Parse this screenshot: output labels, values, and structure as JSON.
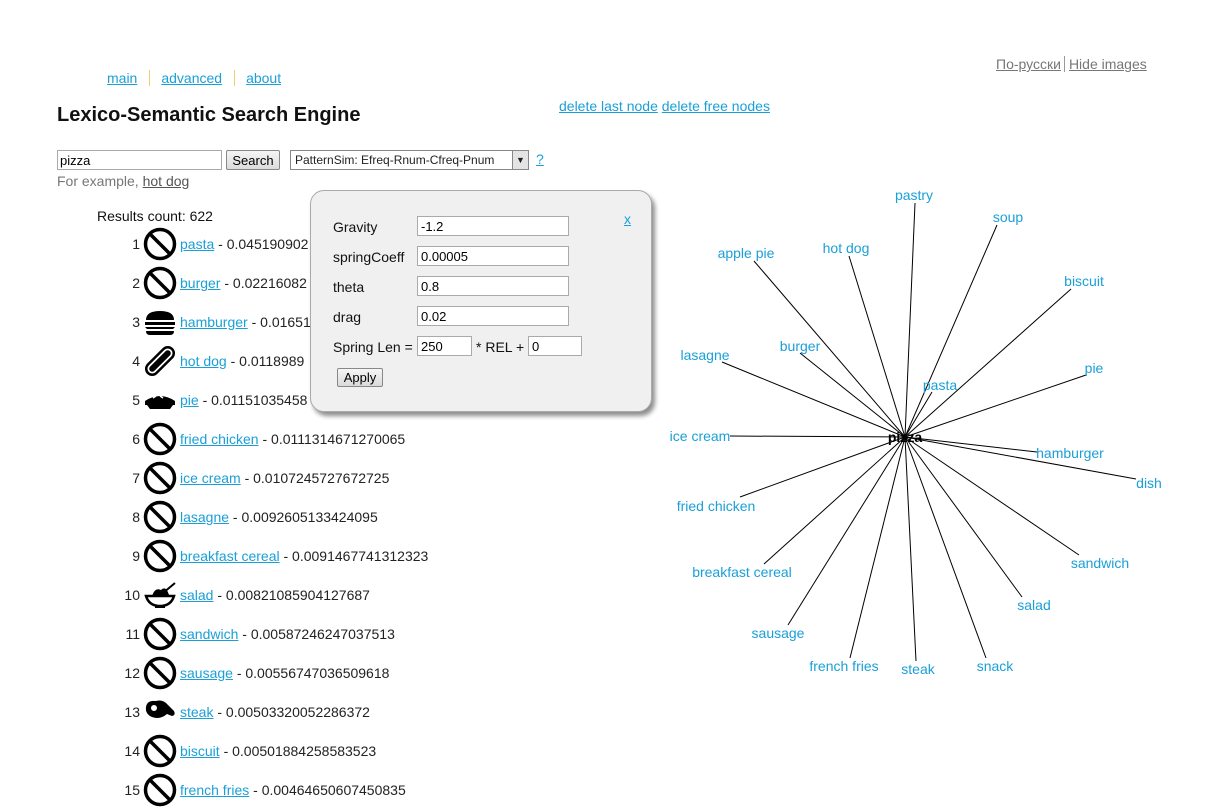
{
  "header": {
    "nav": [
      {
        "label": "main"
      },
      {
        "label": "advanced"
      },
      {
        "label": "about"
      }
    ],
    "lang_link": "По-русски",
    "hide_images_link": "Hide images",
    "title": "Lexico-Semantic Search Engine",
    "delete_last_node": "delete last node",
    "delete_free_nodes": "delete free nodes"
  },
  "search": {
    "query": "pizza",
    "button_label": "Search",
    "method": "PatternSim: Efreq-Rnum-Cfreq-Pnum",
    "help": "?",
    "example_prefix": "For example, ",
    "example_link": "hot dog"
  },
  "results": {
    "count_label": "Results count: 622",
    "items": [
      {
        "rank": "1",
        "word": "pasta",
        "score": " - 0.045190902",
        "icon": "no-image-icon"
      },
      {
        "rank": "2",
        "word": "burger",
        "score": " - 0.02216082",
        "icon": "no-image-icon"
      },
      {
        "rank": "3",
        "word": "hamburger",
        "score": " - 0.01651",
        "icon": "hamburger-icon"
      },
      {
        "rank": "4",
        "word": "hot dog",
        "score": " - 0.0118989",
        "icon": "hot-dog-icon"
      },
      {
        "rank": "5",
        "word": "pie",
        "score": " - 0.01151035458",
        "icon": "pie-icon"
      },
      {
        "rank": "6",
        "word": "fried chicken",
        "score": " - 0.011131467127006 5",
        "icon": "no-image-icon"
      },
      {
        "rank": "7",
        "word": "ice cream",
        "score": " - 0.0107245727672725",
        "icon": "no-image-icon"
      },
      {
        "rank": "8",
        "word": "lasagne",
        "score": " - 0.0092605133424095",
        "icon": "no-image-icon"
      },
      {
        "rank": "9",
        "word": "breakfast cereal",
        "score": " - 0.0091467741312323",
        "icon": "no-image-icon"
      },
      {
        "rank": "10",
        "word": "salad",
        "score": " - 0.00821085904127687",
        "icon": "salad-icon"
      },
      {
        "rank": "11",
        "word": "sandwich",
        "score": " - 0.00587246247037513",
        "icon": "no-image-icon"
      },
      {
        "rank": "12",
        "word": "sausage",
        "score": " - 0.00556747036509618",
        "icon": "no-image-icon"
      },
      {
        "rank": "13",
        "word": "steak",
        "score": " - 0.00503320052286372",
        "icon": "steak-icon"
      },
      {
        "rank": "14",
        "word": "biscuit",
        "score": " - 0.00501884258583523",
        "icon": "no-image-icon"
      },
      {
        "rank": "15",
        "word": "french fries",
        "score": " - 0.00464650607450835",
        "icon": "no-image-icon"
      }
    ]
  },
  "physics_panel": {
    "close": "x",
    "gravity_label": "Gravity",
    "gravity": "-1.2",
    "spring_coeff_label": "springCoeff",
    "spring_coeff": "0.00005",
    "theta_label": "theta",
    "theta": "0.8",
    "drag_label": "drag",
    "drag": "0.02",
    "spring_len_label": "Spring Len =",
    "spring_len": "250",
    "rel_label": "* REL +",
    "rel_offset": "0",
    "apply_label": "Apply"
  },
  "graph": {
    "center": "pizza",
    "nodes": [
      "pastry",
      "soup",
      "hot dog",
      "apple pie",
      "biscuit",
      "burger",
      "lasagne",
      "pie",
      "pasta",
      "ice cream",
      "hamburger",
      "dish",
      "fried chicken",
      "breakfast cereal",
      "sandwich",
      "salad",
      "sausage",
      "french fries",
      "steak",
      "snack"
    ]
  },
  "colors": {
    "link": "#1aa0d8",
    "edge": "#000000"
  }
}
